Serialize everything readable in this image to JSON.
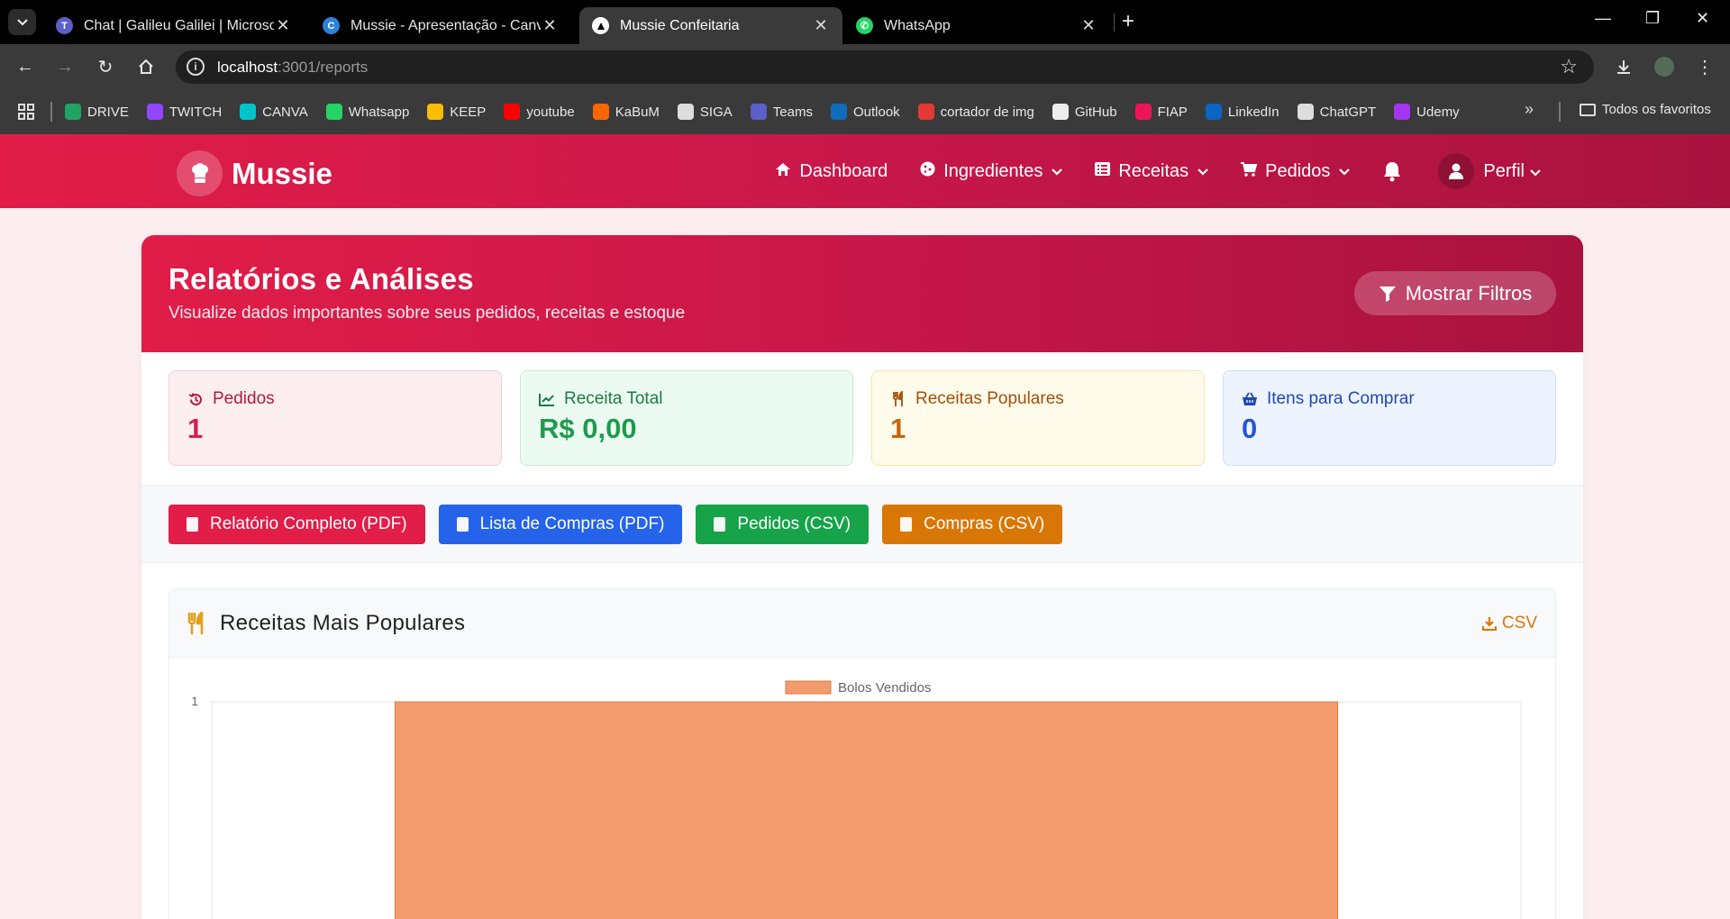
{
  "browser": {
    "tabs": [
      {
        "title": "Chat | Galileu Galilei | Microsoft",
        "icon": "teams-icon",
        "color": "#5b5fc7",
        "active": false
      },
      {
        "title": "Mussie - Apresentação - Canva",
        "icon": "canva-icon",
        "color": "#00c4cc",
        "active": false
      },
      {
        "title": "Mussie Confeitaria",
        "icon": "triangle-icon",
        "color": "#ffffff",
        "active": true
      },
      {
        "title": "WhatsApp",
        "icon": "whatsapp-icon",
        "color": "#25d366",
        "active": false
      }
    ],
    "url_host": "localhost",
    "url_path": ":3001/reports",
    "bookmarks": [
      {
        "label": "DRIVE",
        "icon": "drive-icon",
        "color": "#1fa463"
      },
      {
        "label": "TWITCH",
        "icon": "twitch-icon",
        "color": "#9146ff"
      },
      {
        "label": "CANVA",
        "icon": "canva-icon",
        "color": "#00c4cc"
      },
      {
        "label": "Whatsapp",
        "icon": "whatsapp-icon",
        "color": "#25d366"
      },
      {
        "label": "KEEP",
        "icon": "keep-icon",
        "color": "#fbbc04"
      },
      {
        "label": "youtube",
        "icon": "youtube-icon",
        "color": "#ff0000"
      },
      {
        "label": "KaBuM",
        "icon": "kabum-icon",
        "color": "#ff6500"
      },
      {
        "label": "SIGA",
        "icon": "globe-icon",
        "color": "#dddddd"
      },
      {
        "label": "Teams",
        "icon": "teams-icon",
        "color": "#5b5fc7"
      },
      {
        "label": "Outlook",
        "icon": "outlook-icon",
        "color": "#0f6cbd"
      },
      {
        "label": "cortador de img",
        "icon": "scissors-icon",
        "color": "#e53935"
      },
      {
        "label": "GitHub",
        "icon": "github-icon",
        "color": "#eeeeee"
      },
      {
        "label": "FIAP",
        "icon": "fiap-icon",
        "color": "#ed145b"
      },
      {
        "label": "LinkedIn",
        "icon": "linkedin-icon",
        "color": "#0a66c2"
      },
      {
        "label": "ChatGPT",
        "icon": "chatgpt-icon",
        "color": "#dddddd"
      },
      {
        "label": "Udemy",
        "icon": "udemy-icon",
        "color": "#a435f0"
      }
    ],
    "all_bookmarks_label": "Todos os favoritos"
  },
  "app": {
    "brand": "Mussie",
    "nav": [
      {
        "label": "Dashboard",
        "icon": "home-icon",
        "dropdown": false
      },
      {
        "label": "Ingredientes",
        "icon": "cookie-icon",
        "dropdown": true
      },
      {
        "label": "Receitas",
        "icon": "list-icon",
        "dropdown": true
      },
      {
        "label": "Pedidos",
        "icon": "cart-icon",
        "dropdown": true
      }
    ],
    "profile_label": "Perfil"
  },
  "reports": {
    "title": "Relatórios e Análises",
    "subtitle": "Visualize dados importantes sobre seus pedidos, receitas e estoque",
    "filter_button": "Mostrar Filtros",
    "stats": [
      {
        "label": "Pedidos",
        "value": "1",
        "icon": "history-icon"
      },
      {
        "label": "Receita Total",
        "value": "R$ 0,00",
        "icon": "chart-line-icon"
      },
      {
        "label": "Receitas Populares",
        "value": "1",
        "icon": "utensils-icon"
      },
      {
        "label": "Itens para Comprar",
        "value": "0",
        "icon": "basket-icon"
      }
    ],
    "exports": [
      {
        "label": "Relatório Completo (PDF)",
        "color": "#e11d48"
      },
      {
        "label": "Lista de Compras (PDF)",
        "color": "#2563eb"
      },
      {
        "label": "Pedidos (CSV)",
        "color": "#16a34a"
      },
      {
        "label": "Compras (CSV)",
        "color": "#d97706"
      }
    ],
    "popular_title": "Receitas Mais Populares",
    "popular_csv": "CSV"
  },
  "chart_data": {
    "type": "bar",
    "categories": [
      ""
    ],
    "series": [
      {
        "name": "Bolos Vendidos",
        "values": [
          1
        ],
        "color": "#f29b6c"
      }
    ],
    "ylim": [
      0,
      1
    ],
    "ytick_labels": [
      "1"
    ],
    "legend": "top-center"
  }
}
